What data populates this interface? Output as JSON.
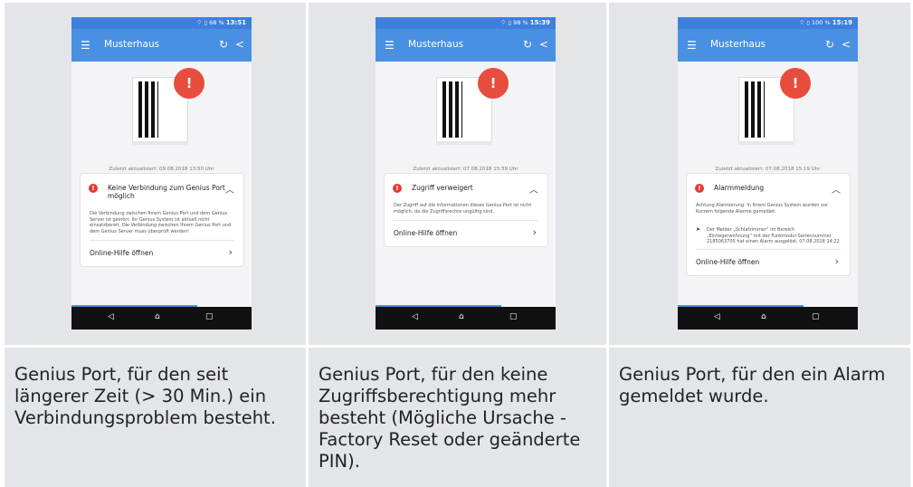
{
  "panels": [
    {
      "status": {
        "icons": "⌔ ▯ 68 %",
        "time": "13:51"
      },
      "appbar": {
        "title": "Musterhaus"
      },
      "updated": "Zuletzt aktualisiert: 09.08.2018 13:50 Uhr",
      "card": {
        "title": "Keine Verbindung zum Genius Port möglich",
        "body": "Die Verbindung zwischen Ihrem Genius Port und dem Genius Server ist gestört. Ihr Genius System ist aktuell nicht einsatzbereit. Die Verbindung zwischen Ihrem Genius Port und dem Genius Server muss überprüft werden!",
        "link": "Online-Hilfe öffnen"
      },
      "caption": "Genius Port, für den seit längerer Zeit (> 30 Min.) ein Verbindungsproblem besteht."
    },
    {
      "status": {
        "icons": "⌔ ▯ 98 %",
        "time": "15:39"
      },
      "appbar": {
        "title": "Musterhaus"
      },
      "updated": "Zuletzt aktualisiert: 07.08.2018 15:39 Uhr",
      "card": {
        "title": "Zugriff verweigert",
        "body": "Der Zugriff auf die Informationen dieses Genius Port ist nicht möglich, da die Zugriffsrechte ungültig sind.",
        "link": "Online-Hilfe öffnen"
      },
      "caption": "Genius Port, für den keine Zugriffsberechtigung mehr besteht (Mögliche Ursache - Factory Reset oder geänderte PIN)."
    },
    {
      "status": {
        "icons": "⌔ ▯ 100 %",
        "time": "15:19"
      },
      "appbar": {
        "title": "Musterhaus"
      },
      "updated": "Zuletzt aktualisiert: 07.08.2018 15:19 Uhr",
      "card": {
        "title": "Alarmmeldung",
        "body": "Achtung Alarmierung: In Ihrem Genius System wurden vor Kurzem folgende Alarme gemeldet:",
        "alarm": "Der Melder „Schlafzimmer“ im Bereich „Einliegerwohnung“ mit der Funkmodul-Seriennummer 2185063705 hat einen Alarm ausgelöst. 07.08.2018 14:22",
        "link": "Online-Hilfe öffnen"
      },
      "caption": "Genius Port, für den ein Alarm gemeldet wurde."
    }
  ],
  "icons": {
    "menu": "menu-icon",
    "refresh": "refresh-icon",
    "share": "share-icon",
    "error": "error-icon",
    "back": "back-icon",
    "home": "home-icon",
    "recent": "recent-apps-icon"
  },
  "colors": {
    "appbar": "#4a90e2",
    "statusbar": "#3f7fdc",
    "alert": "#e74c3c",
    "panel_bg": "#e3e5e8"
  }
}
